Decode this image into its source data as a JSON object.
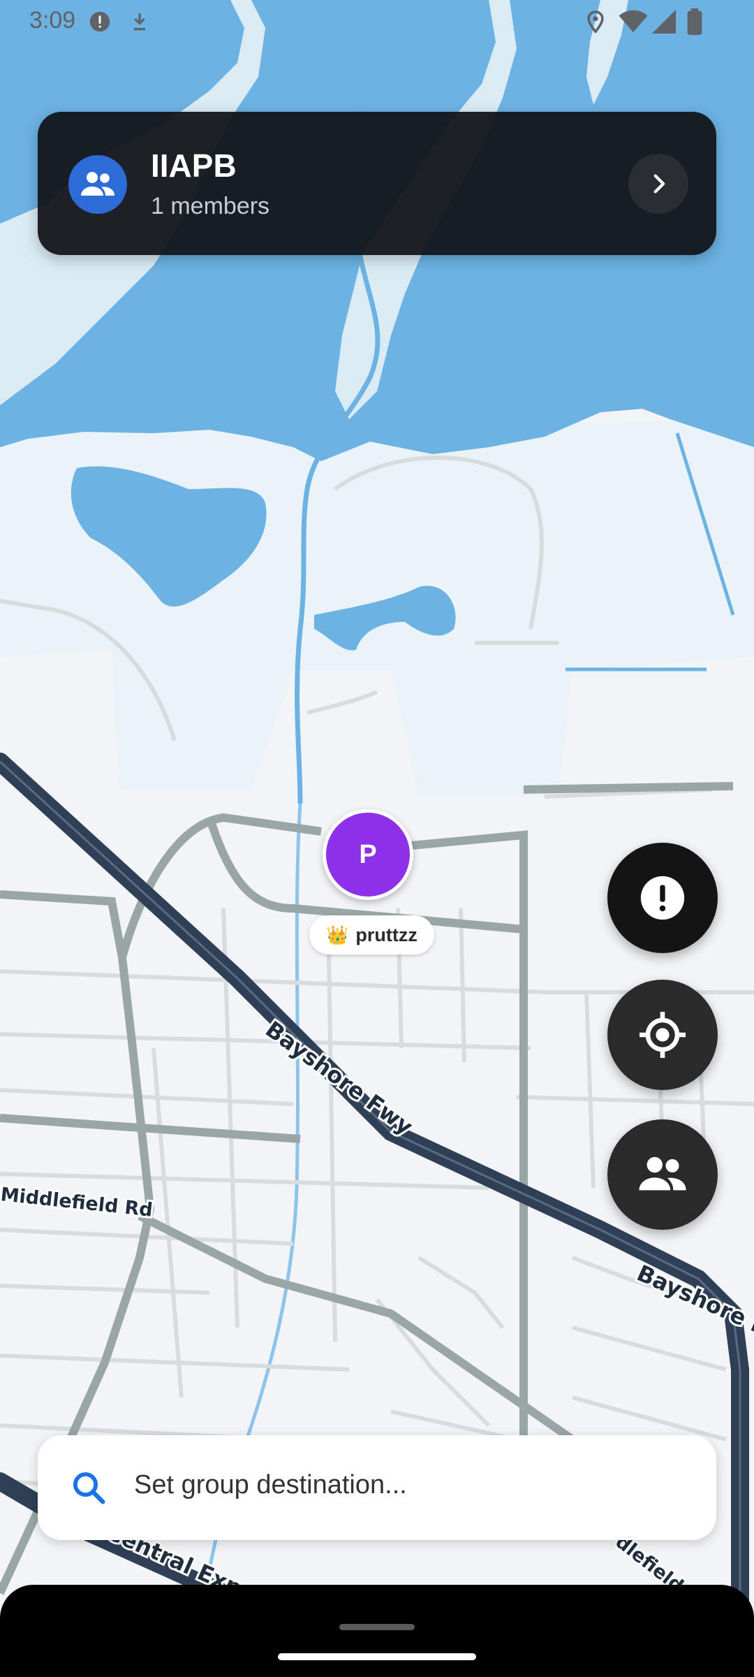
{
  "status_bar": {
    "time": "3:09",
    "icons": [
      "alert-circle-icon",
      "download-arrow-icon",
      "location-pin-icon",
      "wifi-icon",
      "signal-icon",
      "battery-icon"
    ]
  },
  "group_card": {
    "icon": "group-icon",
    "name": "IIAPB",
    "members": "1 members",
    "open_icon": "chevron-right-icon"
  },
  "map": {
    "road_labels": [
      "Bayshore Fwy",
      "Bayshore F",
      "Middlefield Rd",
      "Central Expy",
      "dlefield Rd"
    ],
    "user_marker": {
      "initial": "P",
      "crown": "👑",
      "name": "pruttzz",
      "color": "#8e30e8"
    }
  },
  "fabs": {
    "alert_icon": "exclamation-icon",
    "locate_icon": "crosshair-icon",
    "group_icon": "group-icon"
  },
  "search": {
    "icon": "search-icon",
    "placeholder": "Set group destination..."
  },
  "colors": {
    "water": "#6cb2e3",
    "land": "#f2f4f7",
    "freeway": "#2f3f55",
    "major_road": "#9aa6a6",
    "card_bg": "#111418",
    "accent_blue": "#2d6bd6",
    "search_icon": "#1a73e8"
  }
}
